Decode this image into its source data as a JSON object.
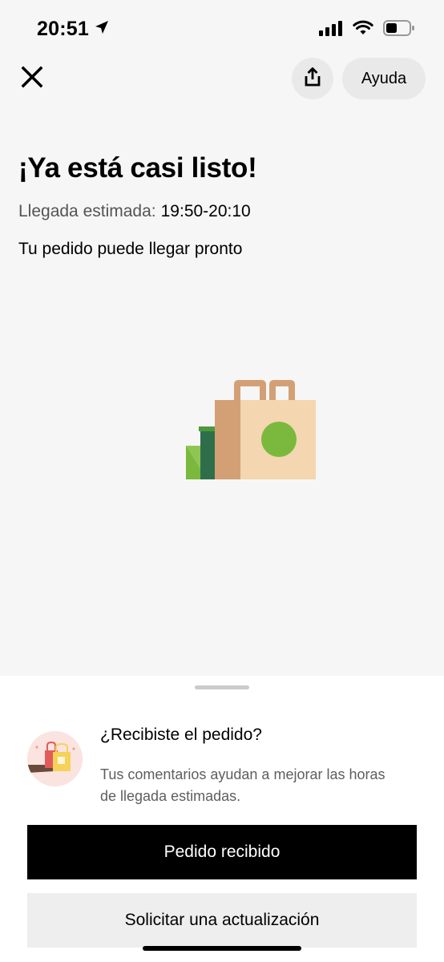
{
  "status_bar": {
    "time": "20:51",
    "icons": [
      "location-arrow-icon",
      "cellular-signal-icon",
      "wifi-icon",
      "battery-icon"
    ]
  },
  "header": {
    "close_icon": "close-icon",
    "share_icon": "share-icon",
    "help_label": "Ayuda"
  },
  "main": {
    "headline": "¡Ya está casi listo!",
    "eta_label": "Llegada estimada:",
    "eta_value": "19:50-20:10",
    "subtext": "Tu pedido puede llegar pronto"
  },
  "sheet": {
    "title": "¿Recibiste el pedido?",
    "description": "Tus comentarios ayudan a mejorar las horas de llegada estimadas.",
    "primary_button": "Pedido recibido",
    "secondary_button": "Solicitar una actualización"
  },
  "colors": {
    "primary_button_bg": "#000000",
    "secondary_button_bg": "#eeeeee",
    "bag_green": "#7ab93d",
    "bag_tan": "#f4d6b0",
    "bag_brown": "#d3a076"
  }
}
